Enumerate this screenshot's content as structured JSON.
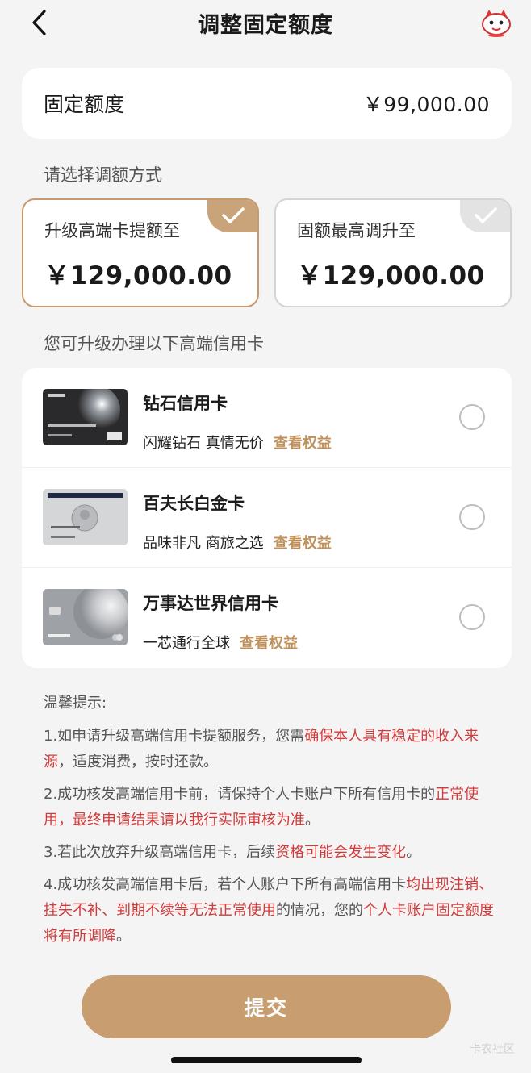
{
  "nav": {
    "title": "调整固定额度",
    "back_icon": "chevron-left-icon",
    "mascot_icon": "mascot-icon"
  },
  "quota": {
    "label": "固定额度",
    "value": "￥99,000.00"
  },
  "method_section_label": "请选择调额方式",
  "options": [
    {
      "title": "升级高端卡提额至",
      "amount": "￥129,000.00",
      "selected": true
    },
    {
      "title": "固额最高调升至",
      "amount": "￥129,000.00",
      "selected": false
    }
  ],
  "cards_section_label": "您可升级办理以下高端信用卡",
  "cards": [
    {
      "name": "钻石信用卡",
      "desc": "闪耀钻石 真情无价",
      "benefit": "查看权益"
    },
    {
      "name": "百夫长白金卡",
      "desc": "品味非凡 商旅之选",
      "benefit": "查看权益"
    },
    {
      "name": "万事达世界信用卡",
      "desc": "一芯通行全球",
      "benefit": "查看权益"
    }
  ],
  "tips": {
    "title": "温馨提示:",
    "t1_a": "1.如申请升级高端信用卡提额服务，您需",
    "t1_b": "确保本人具有稳定的收入来源",
    "t1_c": "，适度消费，按时还款。",
    "t2_a": "2.成功核发高端信用卡前，请保持个人卡账户下所有信用卡的",
    "t2_b": "正常使用，最终申请结果请以我行实际审核为准",
    "t2_c": "。",
    "t3_a": "3.若此次放弃升级高端信用卡，后续",
    "t3_b": "资格可能会发生变化",
    "t3_c": "。",
    "t4_a": "4.成功核发高端信用卡后，若个人账户下所有高端信用卡",
    "t4_b": "均出现注销、挂失不补、到期不续等无法正常使用",
    "t4_c": "的情况，您的",
    "t4_d": "个人卡账户固定额度将有所调降",
    "t4_e": "。"
  },
  "submit_label": "提交",
  "watermark": "卡农社区",
  "colors": {
    "accent": "#c89e70",
    "warning": "#d33a3a",
    "background": "#f4f4f5"
  }
}
